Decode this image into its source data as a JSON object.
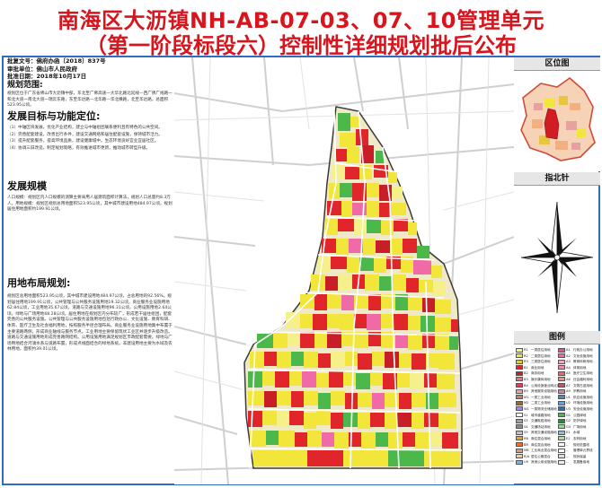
{
  "header": {
    "title_line1": "南海区大沥镇NH-AB-07-03、07、10管理单元",
    "title_line2": "（第一阶段标段六）控制性详细规划批后公布"
  },
  "meta": {
    "approval_no": "批复文号：佛府办函〔2018〕837号",
    "approver": "审批单位：佛山市人民政府",
    "approval_date": "批准日期：2018年10月17日"
  },
  "sections": {
    "scope_title": "规划范围:",
    "scope_text": "规划区位于广东省佛山市大沥镇中部，东北至广佛高速一大华北路北延线—西广佛广线路一和北大道一南北大道一瑞云东路，东至华达路—北华路—华北横路，北至华达路，总面积523.95公顷。",
    "goals_title": "发展目标与功能定位:",
    "goals_items": [
      "（1）中轴区块发展，优化产业结构，建立与中轴组团联系便利且有特色的公共空间。",
      "（2）完善配套建设，改善出行条件，建设交通网络和居住配套设施，保持城市活力。",
      "（3）提升配套服务，提高环境品质，建设健康城中。生态环境良好宜业宜居社区。",
      "（4）协调三旧改造，制定规划策略，有效推进城市更新，推动城市转型升级。"
    ],
    "scale_title": "发展规模",
    "scale_text": "人口规模：规划区内人口规模的测算主要采用人居建筑面积计算法，规划人口总量约8.3万人。用地规模：规划区规划总用地面积523.95公顷，其中城市建设用地484.97公顷。规划居住用地面积约199.91公顷。",
    "landuse_title": "用地布局规划:",
    "landuse_text": "规划区总用地面积523.95公顷，其中城市建设用地484.97公顷，占总用地的92.56%。规划居住用地199.91公顷，公共管理与公共服务设施用地19.32公顷，商业服务业设施用地62.84公顷，工业用地35.67公顷，道路与交通设施用地96.31公顷，公用设施用地2.64公顷，绿地与广场用地68.28公顷。居住用地在规划区内分布较广，形成若干居住组团，配套完善的公共服务设施。公共管理与公共服务设施用地包括行政办公、文化设施、教育科研、体育、医疗卫生及社会福利用地，按照服务半径合理布局。商业服务业设施用地集中布置于主要道路两侧，形成商业轴线与服务节点。工业用地主要保留现状工业区并逐步升级改造。道路与交通设施用地形成完善路网结构。公用设施用地满足规划区市政配套需要。绿地与广场用地结合河涌水系与道路布置，形成点线面结合的绿地系统。非建设用地主要为水域及农林用地，面积约39.01公顷。"
  },
  "right_panel": {
    "location_title": "区位图",
    "north_title": "指北针",
    "legend_title": "图例"
  },
  "legend": {
    "items": [
      {
        "code": "R1",
        "label": "一类居住用地",
        "color": "#f5f08a"
      },
      {
        "code": "A1",
        "label": "行政办公用地",
        "color": "#e84c9a"
      },
      {
        "code": "R2",
        "label": "二类居住用地",
        "color": "#f2e63a"
      },
      {
        "code": "A2",
        "label": "文化设施用地",
        "color": "#f06aa8"
      },
      {
        "code": "R3",
        "label": "三类居住用地",
        "color": "#e8c640"
      },
      {
        "code": "A3",
        "label": "教育科研用地",
        "color": "#f3a6c8"
      },
      {
        "code": "B1",
        "label": "商业用地",
        "color": "#e0262a"
      },
      {
        "code": "A4",
        "label": "体育用地",
        "color": "#f28ca0"
      },
      {
        "code": "B2",
        "label": "商务用地",
        "color": "#c81e28"
      },
      {
        "code": "A5",
        "label": "医疗卫生用地",
        "color": "#e86b6b"
      },
      {
        "code": "B3",
        "label": "娱乐康体用地",
        "color": "#f0706a"
      },
      {
        "code": "A6",
        "label": "社会福利用地",
        "color": "#ef8a88"
      },
      {
        "code": "B4",
        "label": "公用设施营业网点用地",
        "color": "#d94060"
      },
      {
        "code": "A7",
        "label": "文物古迹用地",
        "color": "#b45a6e"
      },
      {
        "code": "B9",
        "label": "其他服务设施用地",
        "color": "#f5a0a0"
      },
      {
        "code": "A9",
        "label": "宗教用地",
        "color": "#cc88aa"
      },
      {
        "code": "M1",
        "label": "一类工业用地",
        "color": "#b88a5a"
      },
      {
        "code": "U1",
        "label": "供应设施用地",
        "color": "#4a8ac4"
      },
      {
        "code": "M2",
        "label": "二类工业用地",
        "color": "#9a6a3a"
      },
      {
        "code": "U2",
        "label": "环境设施用地",
        "color": "#6aa0d0"
      },
      {
        "code": "W1",
        "label": "一类物流仓储用地",
        "color": "#a88ad8"
      },
      {
        "code": "U3",
        "label": "安全设施用地",
        "color": "#3a6aa0"
      },
      {
        "code": "S1",
        "label": "城市道路用地",
        "color": "#ffffff"
      },
      {
        "code": "G1",
        "label": "公园绿地",
        "color": "#4cb84c"
      },
      {
        "code": "S3",
        "label": "交通枢纽用地",
        "color": "#a0a0a0"
      },
      {
        "code": "G2",
        "label": "防护绿地",
        "color": "#2e8a3a"
      },
      {
        "code": "S4",
        "label": "交通场站用地",
        "color": "#8a8a8a"
      },
      {
        "code": "G3",
        "label": "广场用地",
        "color": "#9ad89a"
      },
      {
        "code": "S9",
        "label": "其他交通设施用地",
        "color": "#c0c0c0"
      },
      {
        "code": "E1",
        "label": "水域",
        "color": "#7ac4e8"
      },
      {
        "code": "RB",
        "label": "商住混合用地",
        "color": "#f0a030"
      },
      {
        "code": "E2",
        "label": "农林用地",
        "color": "#b8d88a"
      },
      {
        "code": "BR",
        "label": "商住混合用地",
        "color": "#e8702a"
      },
      {
        "code": "--",
        "label": "规划范围线",
        "color": "#ffffff"
      },
      {
        "code": "MB",
        "label": "工业商业混合用地",
        "color": "#d8a070"
      },
      {
        "code": "--",
        "label": "管理单元界线",
        "color": "#ffffff"
      },
      {
        "code": "R/A",
        "label": "居住公服混合",
        "color": "#f8c8a0"
      },
      {
        "code": "--",
        "label": "现状保留",
        "color": "#dddddd"
      },
      {
        "code": "U9",
        "label": "其他公用设施用地",
        "color": "#88b0d8"
      },
      {
        "code": "--",
        "label": "发展备用地",
        "color": "#eeeeee"
      }
    ]
  },
  "colors": {
    "title_red": "#d8141c",
    "frame_blue": "#2d6cc0",
    "plan_boundary": "#3a3a3a",
    "road_grey": "#cfcfcf",
    "residential": "#f2e63a",
    "commercial": "#e0262a",
    "green": "#4cb84c",
    "public": "#f06aa8"
  }
}
